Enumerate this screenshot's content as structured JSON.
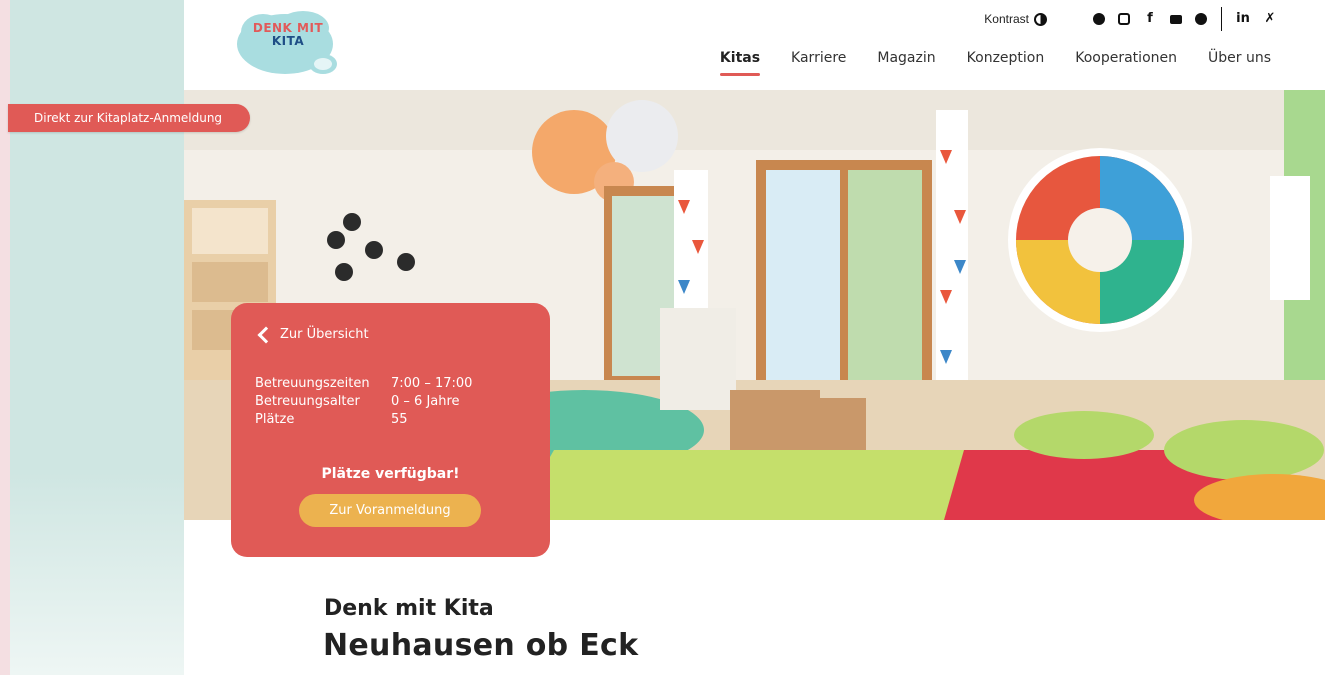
{
  "brand": {
    "logo_line1": "DENK MIT",
    "logo_line2": "KITA",
    "logo_colors": [
      "#e15a5a",
      "#1f4e86",
      "#9fd9dc"
    ]
  },
  "topbar": {
    "contrast_label": "Kontrast",
    "social_icons": [
      "pinterest-icon",
      "instagram-icon",
      "facebook-icon",
      "youtube-icon",
      "spotify-icon",
      "linkedin-icon",
      "xing-icon"
    ]
  },
  "nav": {
    "items": [
      {
        "label": "Kitas",
        "active": true
      },
      {
        "label": "Karriere"
      },
      {
        "label": "Magazin"
      },
      {
        "label": "Konzeption"
      },
      {
        "label": "Kooperationen"
      },
      {
        "label": "Über uns"
      }
    ]
  },
  "sidebar": {
    "cta_label": "Direkt zur Kitaplatz-Anmeldung"
  },
  "card": {
    "back_label": "Zur Übersicht",
    "rows": [
      {
        "key": "Betreuungszeiten",
        "value": "7:00 – 17:00"
      },
      {
        "key": "Betreuungsalter",
        "value": "0 – 6 Jahre"
      },
      {
        "key": "Plätze",
        "value": "55"
      }
    ],
    "availability": "Plätze verfügbar!",
    "button_label": "Zur Voranmeldung"
  },
  "page": {
    "title_small": "Denk mit Kita",
    "title_large": "Neuhausen ob Eck"
  },
  "colors": {
    "accent": "#e05a56",
    "button": "#ecb24f",
    "sidebar": "#cfe6e2",
    "frame": "#f6e2e4"
  }
}
